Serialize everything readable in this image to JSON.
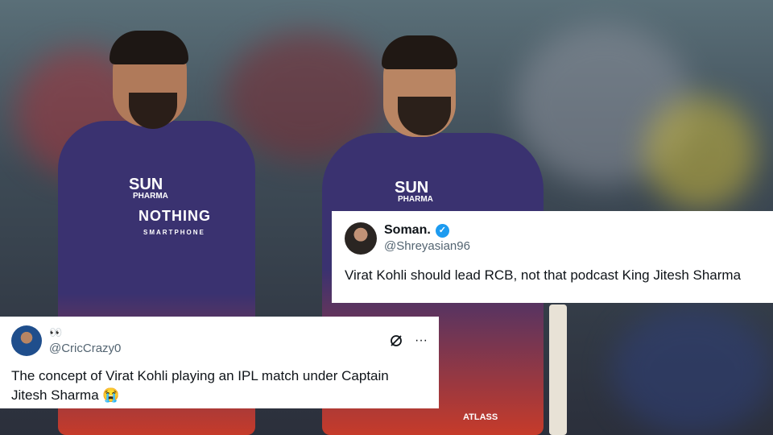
{
  "photo": {
    "left_jersey": {
      "sponsor": "SUN",
      "sponsor_sub": "PHARMA",
      "chest": "NOTHING",
      "chest_sub": "SMARTPHONE"
    },
    "right_jersey": {
      "sponsor": "SUN",
      "sponsor_sub": "PHARMA",
      "lower": "ATLASS"
    }
  },
  "tweet1": {
    "name": "Soman.",
    "handle": "@Shreyasian96",
    "verified_icon": "✓",
    "text": "Virat Kohli should lead RCB, not that podcast King Jitesh Sharma"
  },
  "tweet2": {
    "name": "👀",
    "handle": "@CricCrazy0",
    "text": "The concept of Virat Kohli playing an IPL match under Captain Jitesh Sharma 😭",
    "more_icon": "···"
  }
}
